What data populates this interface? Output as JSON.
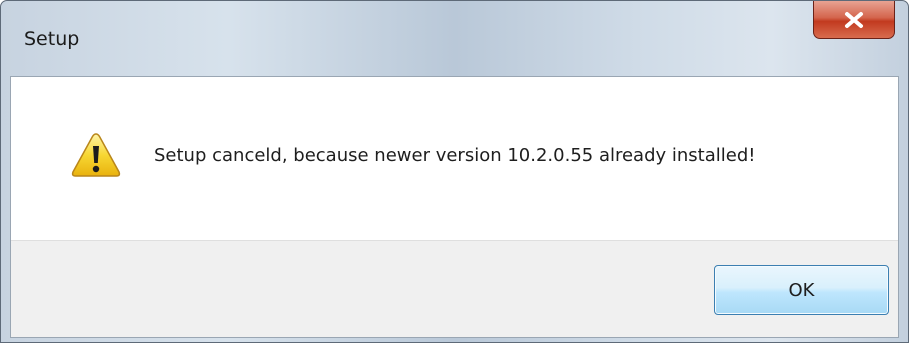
{
  "window": {
    "title": "Setup",
    "close_icon": "close-x-icon"
  },
  "dialog": {
    "icon": "warning-icon",
    "message": "Setup canceld, because newer version 10.2.0.55 already installed!",
    "ok_label": "OK"
  },
  "colors": {
    "close_button": "#c7432a",
    "ok_button_border": "#3c7fb1",
    "warning_fill": "#f5d231"
  }
}
